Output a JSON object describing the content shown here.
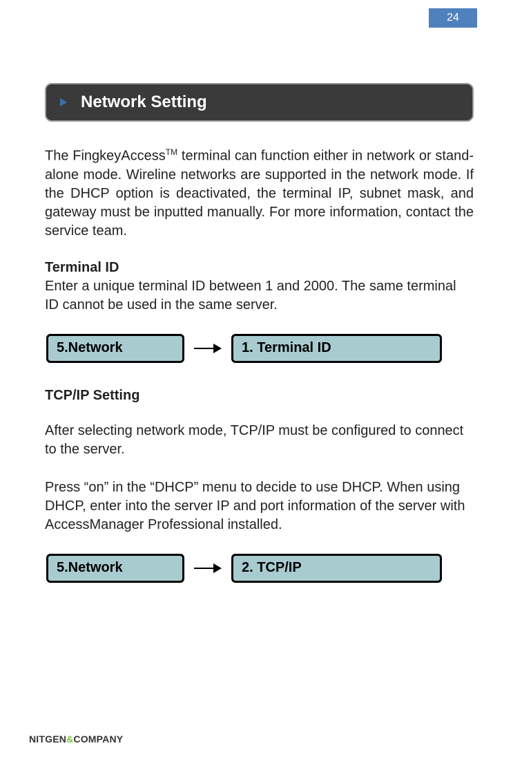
{
  "page_number": "24",
  "section_title": "Network Setting",
  "intro_before_tm": "The FingkeyAccess",
  "tm": "TM",
  "intro_after_tm": " terminal can function either in network or stand-alone mode. Wireline networks are supported in the network mode. If the DHCP option is deactivated, the terminal IP, subnet mask, and gateway must be inputted manually. For more information, contact the service team.",
  "terminal_id_heading": "Terminal ID",
  "terminal_id_text": "Enter a unique terminal ID between 1 and 2000. The same terminal ID cannot be used in the same server.",
  "diagram1_left": "5.Network",
  "diagram1_right": "1. Terminal ID",
  "tcpip_heading": "TCP/IP Setting",
  "tcpip_text1": "After selecting network mode, TCP/IP must be configured to connect to the server.",
  "tcpip_text2": "Press “on” in the “DHCP” menu to decide to use DHCP. When using DHCP, enter into the server IP and port information of the server with AccessManager Professional installed.",
  "diagram2_left": "5.Network",
  "diagram2_right": "2. TCP/IP",
  "footer_brand_a": "NITGEN",
  "footer_brand_amp": "&",
  "footer_brand_b": "COMPANY"
}
